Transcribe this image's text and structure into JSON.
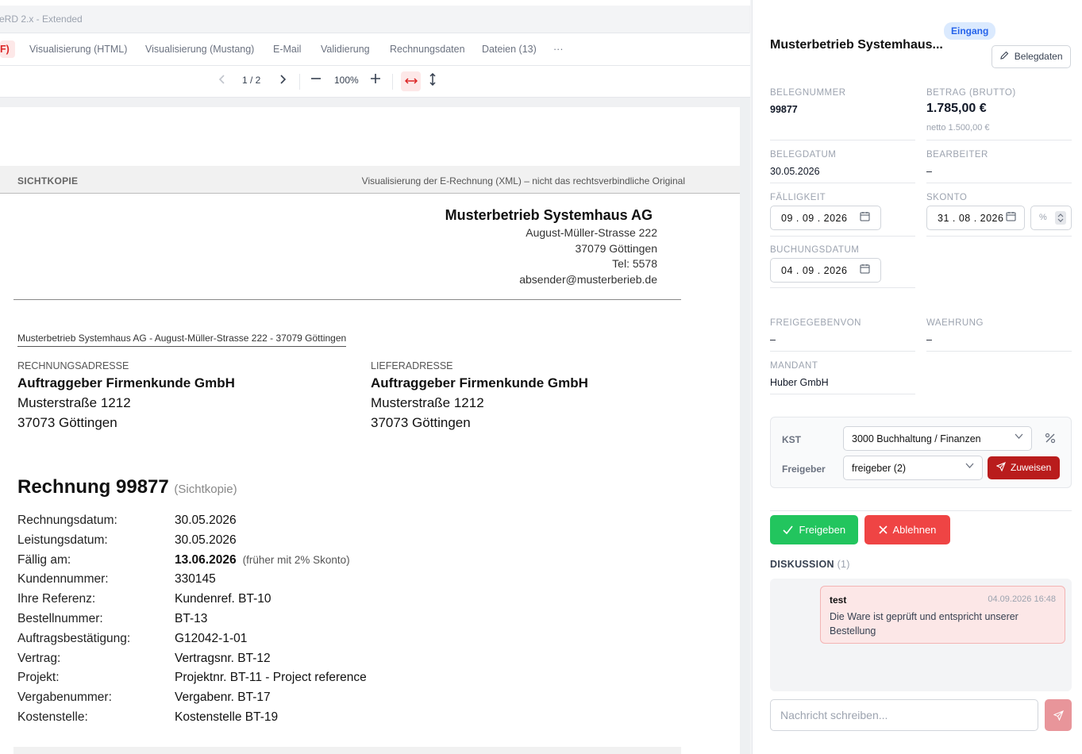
{
  "viewer": {
    "title": "eRD 2.x - Extended",
    "tabs": [
      "F)",
      "Visualisierung (HTML)",
      "Visualisierung (Mustang)",
      "E-Mail",
      "Validierung",
      "Rechnungsdaten",
      "Dateien (13)",
      "···"
    ],
    "page": "1 / 2",
    "zoom": "100%"
  },
  "invoice": {
    "banner_left": "SICHTKOPIE",
    "banner_right": "Visualisierung der E-Rechnung (XML) – nicht das rechtsverbindliche Original",
    "sender": {
      "name": "Musterbetrieb Systemhaus AG",
      "street": "August-Müller-Strasse 222",
      "city": "37079 Göttingen",
      "phone": "Tel: 5578",
      "email": "absender@musterberieb.de"
    },
    "sender_line": "Musterbetrieb Systemhaus AG   -  August-Müller-Strasse 222  -  37079 Göttingen",
    "billing": {
      "label": "RECHNUNGSADRESSE",
      "name": "Auftraggeber Firmenkunde GmbH",
      "street": "Musterstraße 1212",
      "city": "37073 Göttingen"
    },
    "delivery": {
      "label": "LIEFERADRESSE",
      "name": "Auftraggeber Firmenkunde GmbH",
      "street": "Musterstraße 1212",
      "city": "37073 Göttingen"
    },
    "title": "Rechnung 99877",
    "title_sub": "(Sichtkopie)",
    "rows": [
      {
        "label": "Rechnungsdatum:",
        "value": "30.05.2026",
        "note": ""
      },
      {
        "label": "Leistungsdatum:",
        "value": "30.05.2026",
        "note": ""
      },
      {
        "label": "Fällig am:",
        "value": "13.06.2026",
        "note": "(früher mit 2% Skonto)"
      },
      {
        "label": "Kundennummer:",
        "value": "330145",
        "note": ""
      },
      {
        "label": "Ihre Referenz:",
        "value": "Kundenref. BT-10",
        "note": ""
      },
      {
        "label": "Bestellnummer:",
        "value": "BT-13",
        "note": ""
      },
      {
        "label": "Auftragsbestätigung:",
        "value": "G12042-1-01",
        "note": ""
      },
      {
        "label": "Vertrag:",
        "value": "Vertragsnr. BT-12",
        "note": ""
      },
      {
        "label": "Projekt:",
        "value": "Projektnr. BT-11 - Project reference",
        "note": ""
      },
      {
        "label": "Vergabenummer:",
        "value": "Vergabenr. BT-17",
        "note": ""
      },
      {
        "label": "Kostenstelle:",
        "value": "Kostenstelle BT-19",
        "note": ""
      }
    ]
  },
  "panel": {
    "company": "Musterbetrieb Systemhaus...",
    "badge": "Eingang",
    "belegdaten_button": "Belegdaten",
    "belegnummer_label": "BELEGNUMMER",
    "belegnummer": "99877",
    "betrag_label": "BETRAG (BRUTTO)",
    "betrag": "1.785,00 €",
    "netto": "netto 1.500,00 €",
    "belegdatum_label": "BELEGDATUM",
    "belegdatum": "30.05.2026",
    "bearbeiter_label": "BEARBEITER",
    "bearbeiter": "–",
    "faelligkeit_label": "FÄLLIGKEIT",
    "faelligkeit": "09 . 09 . 2026",
    "skonto_label": "SKONTO",
    "skonto": "31 . 08 . 2026",
    "skonto_pct_placeholder": "%",
    "buchungsdatum_label": "BUCHUNGSDATUM",
    "buchungsdatum": "04 . 09 . 2026",
    "freigegebenvon_label": "FREIGEGEBENVON",
    "freigegebenvon": "–",
    "waehrung_label": "WAEHRUNG",
    "waehrung": "–",
    "mandant_label": "MANDANT",
    "mandant": "Huber GmbH",
    "kst_label": "KST",
    "kst_value": "3000 Buchhaltung / Finanzen",
    "freigeber_label": "Freigeber",
    "freigeber_value": "freigeber (2)",
    "zuweisen_button": "Zuweisen",
    "freigeben_button": "Freigeben",
    "ablehnen_button": "Ablehnen",
    "diskussion_label": "DISKUSSION",
    "diskussion_count": "(1)",
    "message": {
      "author": "test",
      "time": "04.09.2026 16:48",
      "text": "Die Ware ist geprüft und entspricht unserer Bestellung"
    },
    "input_placeholder": "Nachricht schreiben..."
  }
}
